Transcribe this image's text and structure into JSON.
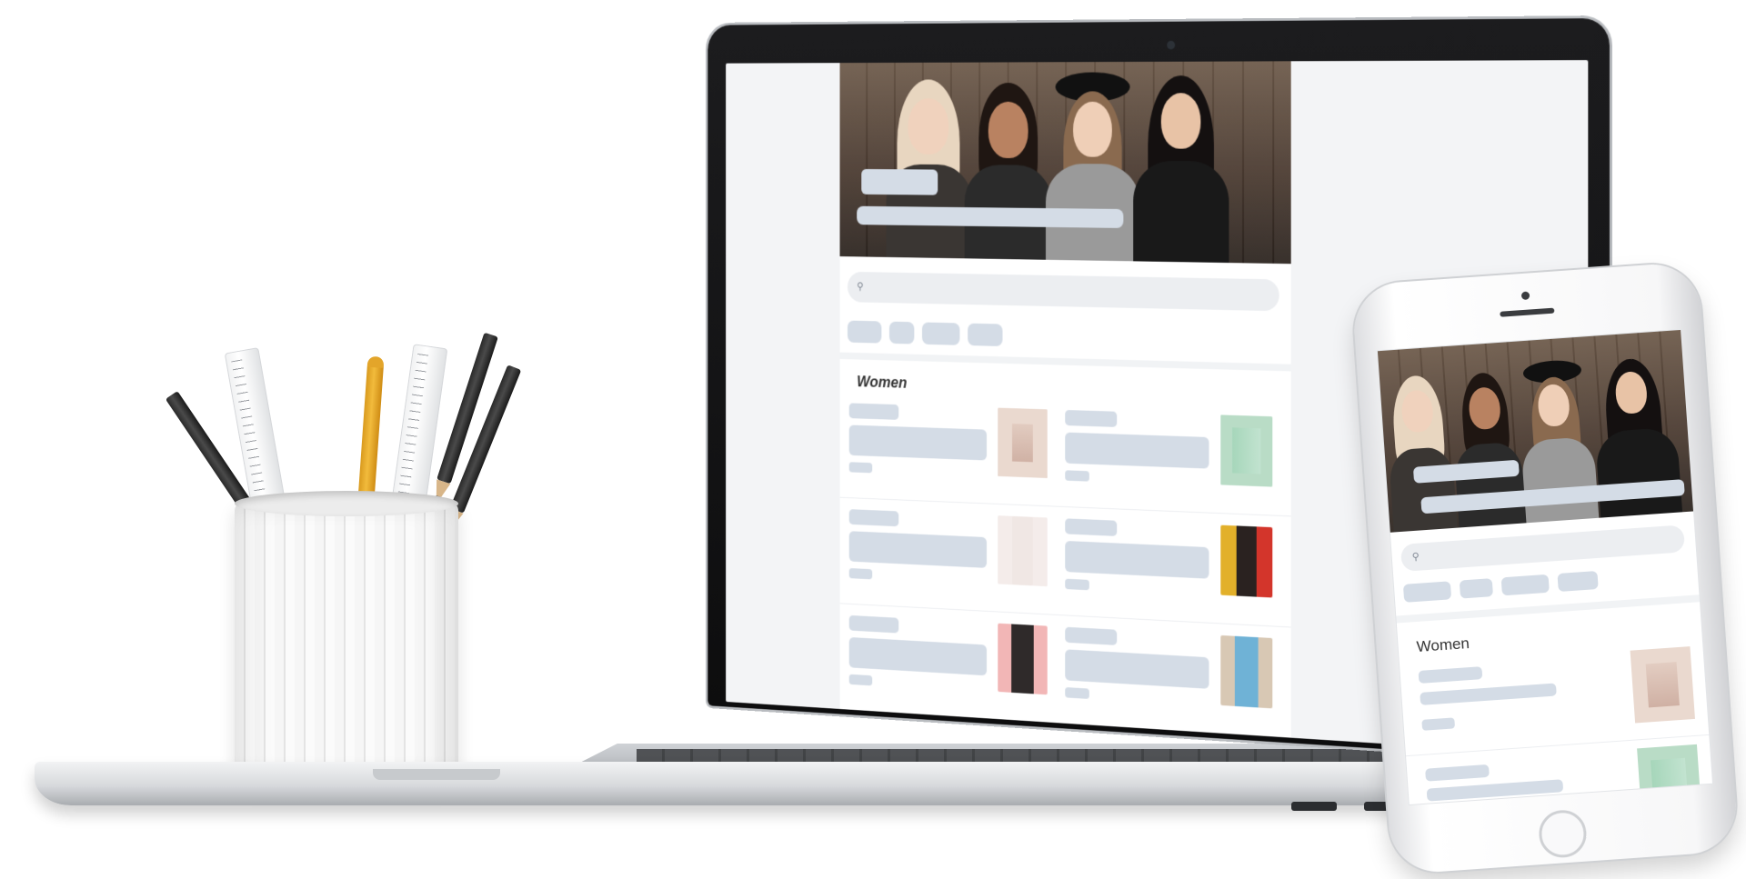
{
  "laptop": {
    "section_title": "Women",
    "search": {
      "placeholder": ""
    }
  },
  "phone": {
    "section_title": "Women"
  },
  "colors": {
    "placeholder": "#d4dce6",
    "page_background": "#f3f4f6",
    "search_background": "#eceef1",
    "laptop_bezel": "#111112"
  },
  "icons": {
    "search": "search-icon"
  }
}
